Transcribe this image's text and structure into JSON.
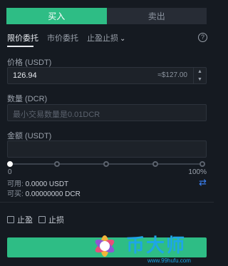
{
  "tabs": {
    "buy": "买入",
    "sell": "卖出"
  },
  "order_types": {
    "limit": "限价委托",
    "market": "市价委托",
    "stop": "止盈止损",
    "help": "?"
  },
  "price": {
    "label": "价格 (USDT)",
    "value": "126.94",
    "approx": "≈$127.00"
  },
  "amount": {
    "label": "数量 (DCR)",
    "placeholder": "最小交易数量是0.01DCR"
  },
  "total": {
    "label": "金额 (USDT)"
  },
  "slider": {
    "min_label": "0",
    "max_label": "100%",
    "value": 0
  },
  "balances": {
    "available_label": "可用:",
    "available_value": "0.0000 USDT",
    "can_buy_label": "可买:",
    "can_buy_value": "0.00000000 DCR"
  },
  "checks": {
    "take_profit": "止盈",
    "stop_loss": "止损"
  },
  "submit": {
    "label": "买入",
    "label_covered": "人"
  },
  "watermark": {
    "text": "币大师",
    "url": "www.99hufu.com"
  },
  "colors": {
    "buy": "#2ebd85",
    "accent": "#3b82f6",
    "background": "#151a21"
  }
}
